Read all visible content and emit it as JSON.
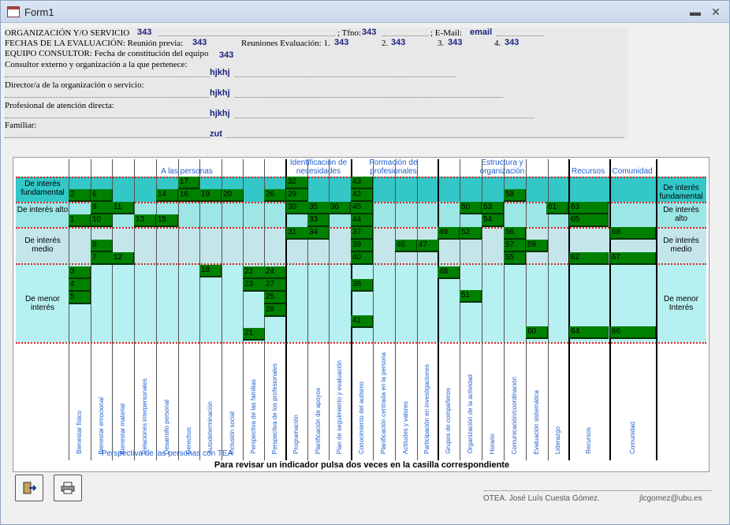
{
  "window": {
    "title": "Form1",
    "minimize": "▬",
    "close": "✕"
  },
  "header": {
    "org_label": "ORGANIZACIÓN Y/O SERVICIO",
    "org_value": "343",
    "tfno_label": "; Tfno:",
    "tfno_value": "343",
    "email_label": "; E-Mail:",
    "email_value": "email",
    "fechas_label": "FECHAS DE LA EVALUACIÓN: Reunión previa:",
    "fechas_value": "343",
    "reuniones_label": "Reuniones Evaluación: 1.",
    "r1": "343",
    "r2_label": "2.",
    "r2": "343",
    "r3_label": "3.",
    "r3": "343",
    "r4_label": "4.",
    "r4": "343",
    "equipo_label": "EQUIPO CONSULTOR: Fecha de constitución del equipo",
    "equipo_value": "343",
    "consultor_label": "Consultor externo y organización a la que pertenece:",
    "consultor_value": "hjkhj",
    "director_label": "Director/a de la organización o servicio:",
    "director_value": "hjkhj",
    "profesional_label": "Profesional de atención directa:",
    "profesional_value": "hjkhj",
    "familiar_label": "Familiar:",
    "familiar_value": "zut"
  },
  "groups": [
    {
      "label": "A las personas"
    },
    {
      "label": "Identificación de necesidades"
    },
    {
      "label": "Formación de profesionales"
    },
    {
      "label": "Estructura y organización"
    },
    {
      "label": "Recursos"
    },
    {
      "label": "Comunidad"
    }
  ],
  "rows": [
    {
      "left": "De interés fundamental",
      "right": "De interés fundamental"
    },
    {
      "left": "De interés alto",
      "right": "De interés alto"
    },
    {
      "left": "De interés medio",
      "right": "De interés medio"
    },
    {
      "left": "De menor interés",
      "right": "De menor Interés"
    }
  ],
  "columns": [
    "Bienestar físico",
    "Bienestar emocional",
    "Bienestar material",
    "Relaciones interpersonales",
    "Desarrollo personal",
    "Derechos",
    "Autodeterminación",
    "Inclusión social",
    "Perspectiva de las familias",
    "Perspectiva de los profesionales",
    "Programación",
    "Planificación de apoyos",
    "Plan de seguimiento y evaluación",
    "Conocimiento del autismo",
    "Planificación centrada en la persona",
    "Actitudes y valores",
    "Participación en investigaciones",
    "Grupos de compañeros",
    "Organización de la actividad",
    "Horario",
    "Comunicación/coordinación",
    "Evaluación sistemática",
    "Liderazgo",
    "Recursos",
    "Comunidad"
  ],
  "subgroup_label": "Perspectiva de las personas con TEA",
  "cells": [
    "17",
    "2",
    "6",
    "14",
    "16",
    "19",
    "20",
    "26",
    "8",
    "11",
    "1",
    "10",
    "13",
    "15",
    "9",
    "7",
    "12",
    "18",
    "3",
    "4",
    "5",
    "22",
    "24",
    "23",
    "27",
    "25",
    "28",
    "21",
    "32",
    "29",
    "30",
    "35",
    "36",
    "33",
    "31",
    "34",
    "43",
    "42",
    "45",
    "44",
    "37",
    "39",
    "40",
    "46",
    "47",
    "38",
    "41",
    "50",
    "53",
    "54",
    "49",
    "52",
    "48",
    "51",
    "58",
    "56",
    "57",
    "55",
    "59",
    "60",
    "61",
    "63",
    "65",
    "62",
    "64",
    "68",
    "67",
    "66"
  ],
  "bottom_message": "Para revisar un indicador pulsa dos veces en la casilla correspondiente",
  "footer": {
    "author": "OTEA. José Luís Cuesta Gómez.",
    "email": "jlcgomez@ubu.es"
  },
  "colors": {
    "cell": "#008000",
    "band_top": "#33c7c7",
    "band_alt": "#9de6e6",
    "band_mid": "#c4e6ea",
    "band_low": "#b6f0f0",
    "header_text": "#1f5fd0"
  }
}
